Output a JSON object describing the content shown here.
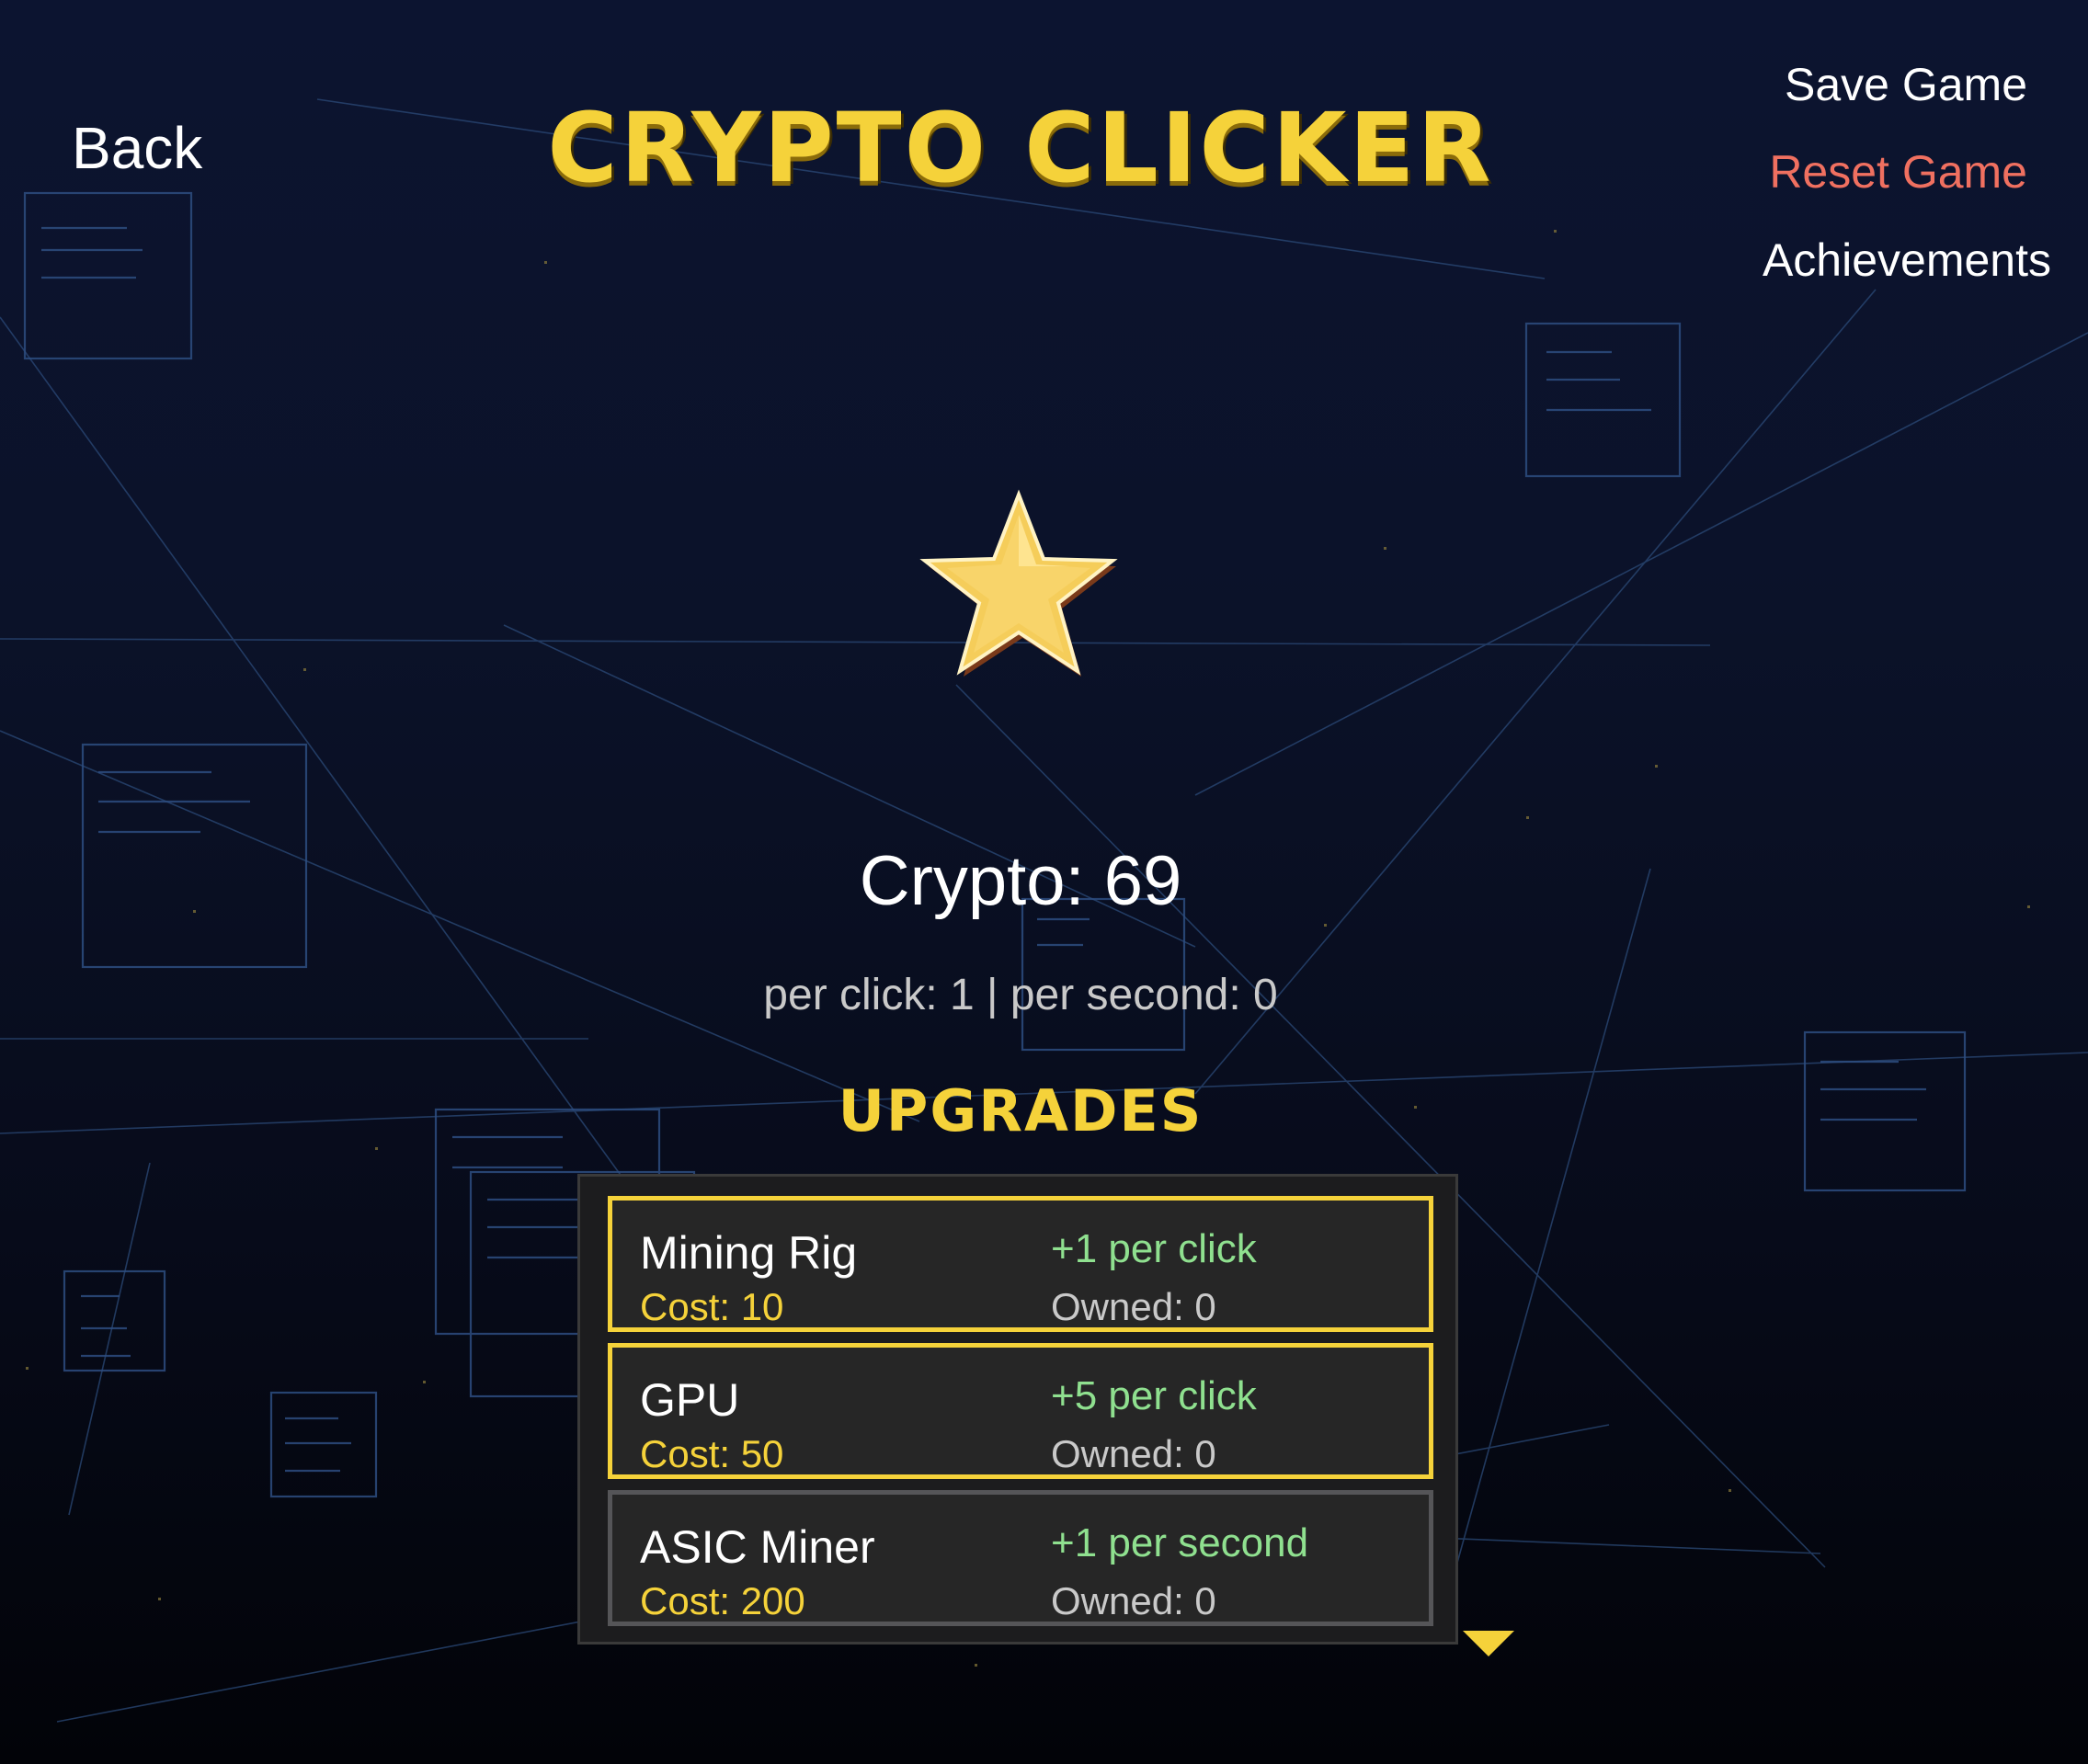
{
  "game": {
    "title": "CRYPTO CLICKER"
  },
  "nav": {
    "back_label": "Back",
    "save_label": "Save Game",
    "reset_label": "Reset Game",
    "achievements_label": "Achievements"
  },
  "colors": {
    "accent_gold": "#f5d23a",
    "reset_red": "#f07060",
    "effect_green": "#8fe08f",
    "background": "#0b1229"
  },
  "stats": {
    "crypto_text": "Crypto: 69",
    "rates_text": "per click: 1 | per second: 0"
  },
  "coin": {
    "icon": "star-icon"
  },
  "upgrades": {
    "heading": "UPGRADES",
    "items": [
      {
        "name": "Mining Rig",
        "cost": "Cost: 10",
        "effect": "+1 per click",
        "owned": "Owned: 0",
        "affordable": true
      },
      {
        "name": "GPU",
        "cost": "Cost: 50",
        "effect": "+5 per click",
        "owned": "Owned: 0",
        "affordable": true
      },
      {
        "name": "ASIC Miner",
        "cost": "Cost: 200",
        "effect": "+1 per second",
        "owned": "Owned: 0",
        "affordable": false
      }
    ],
    "scroll_icon": "scroll-down-arrow-icon"
  }
}
